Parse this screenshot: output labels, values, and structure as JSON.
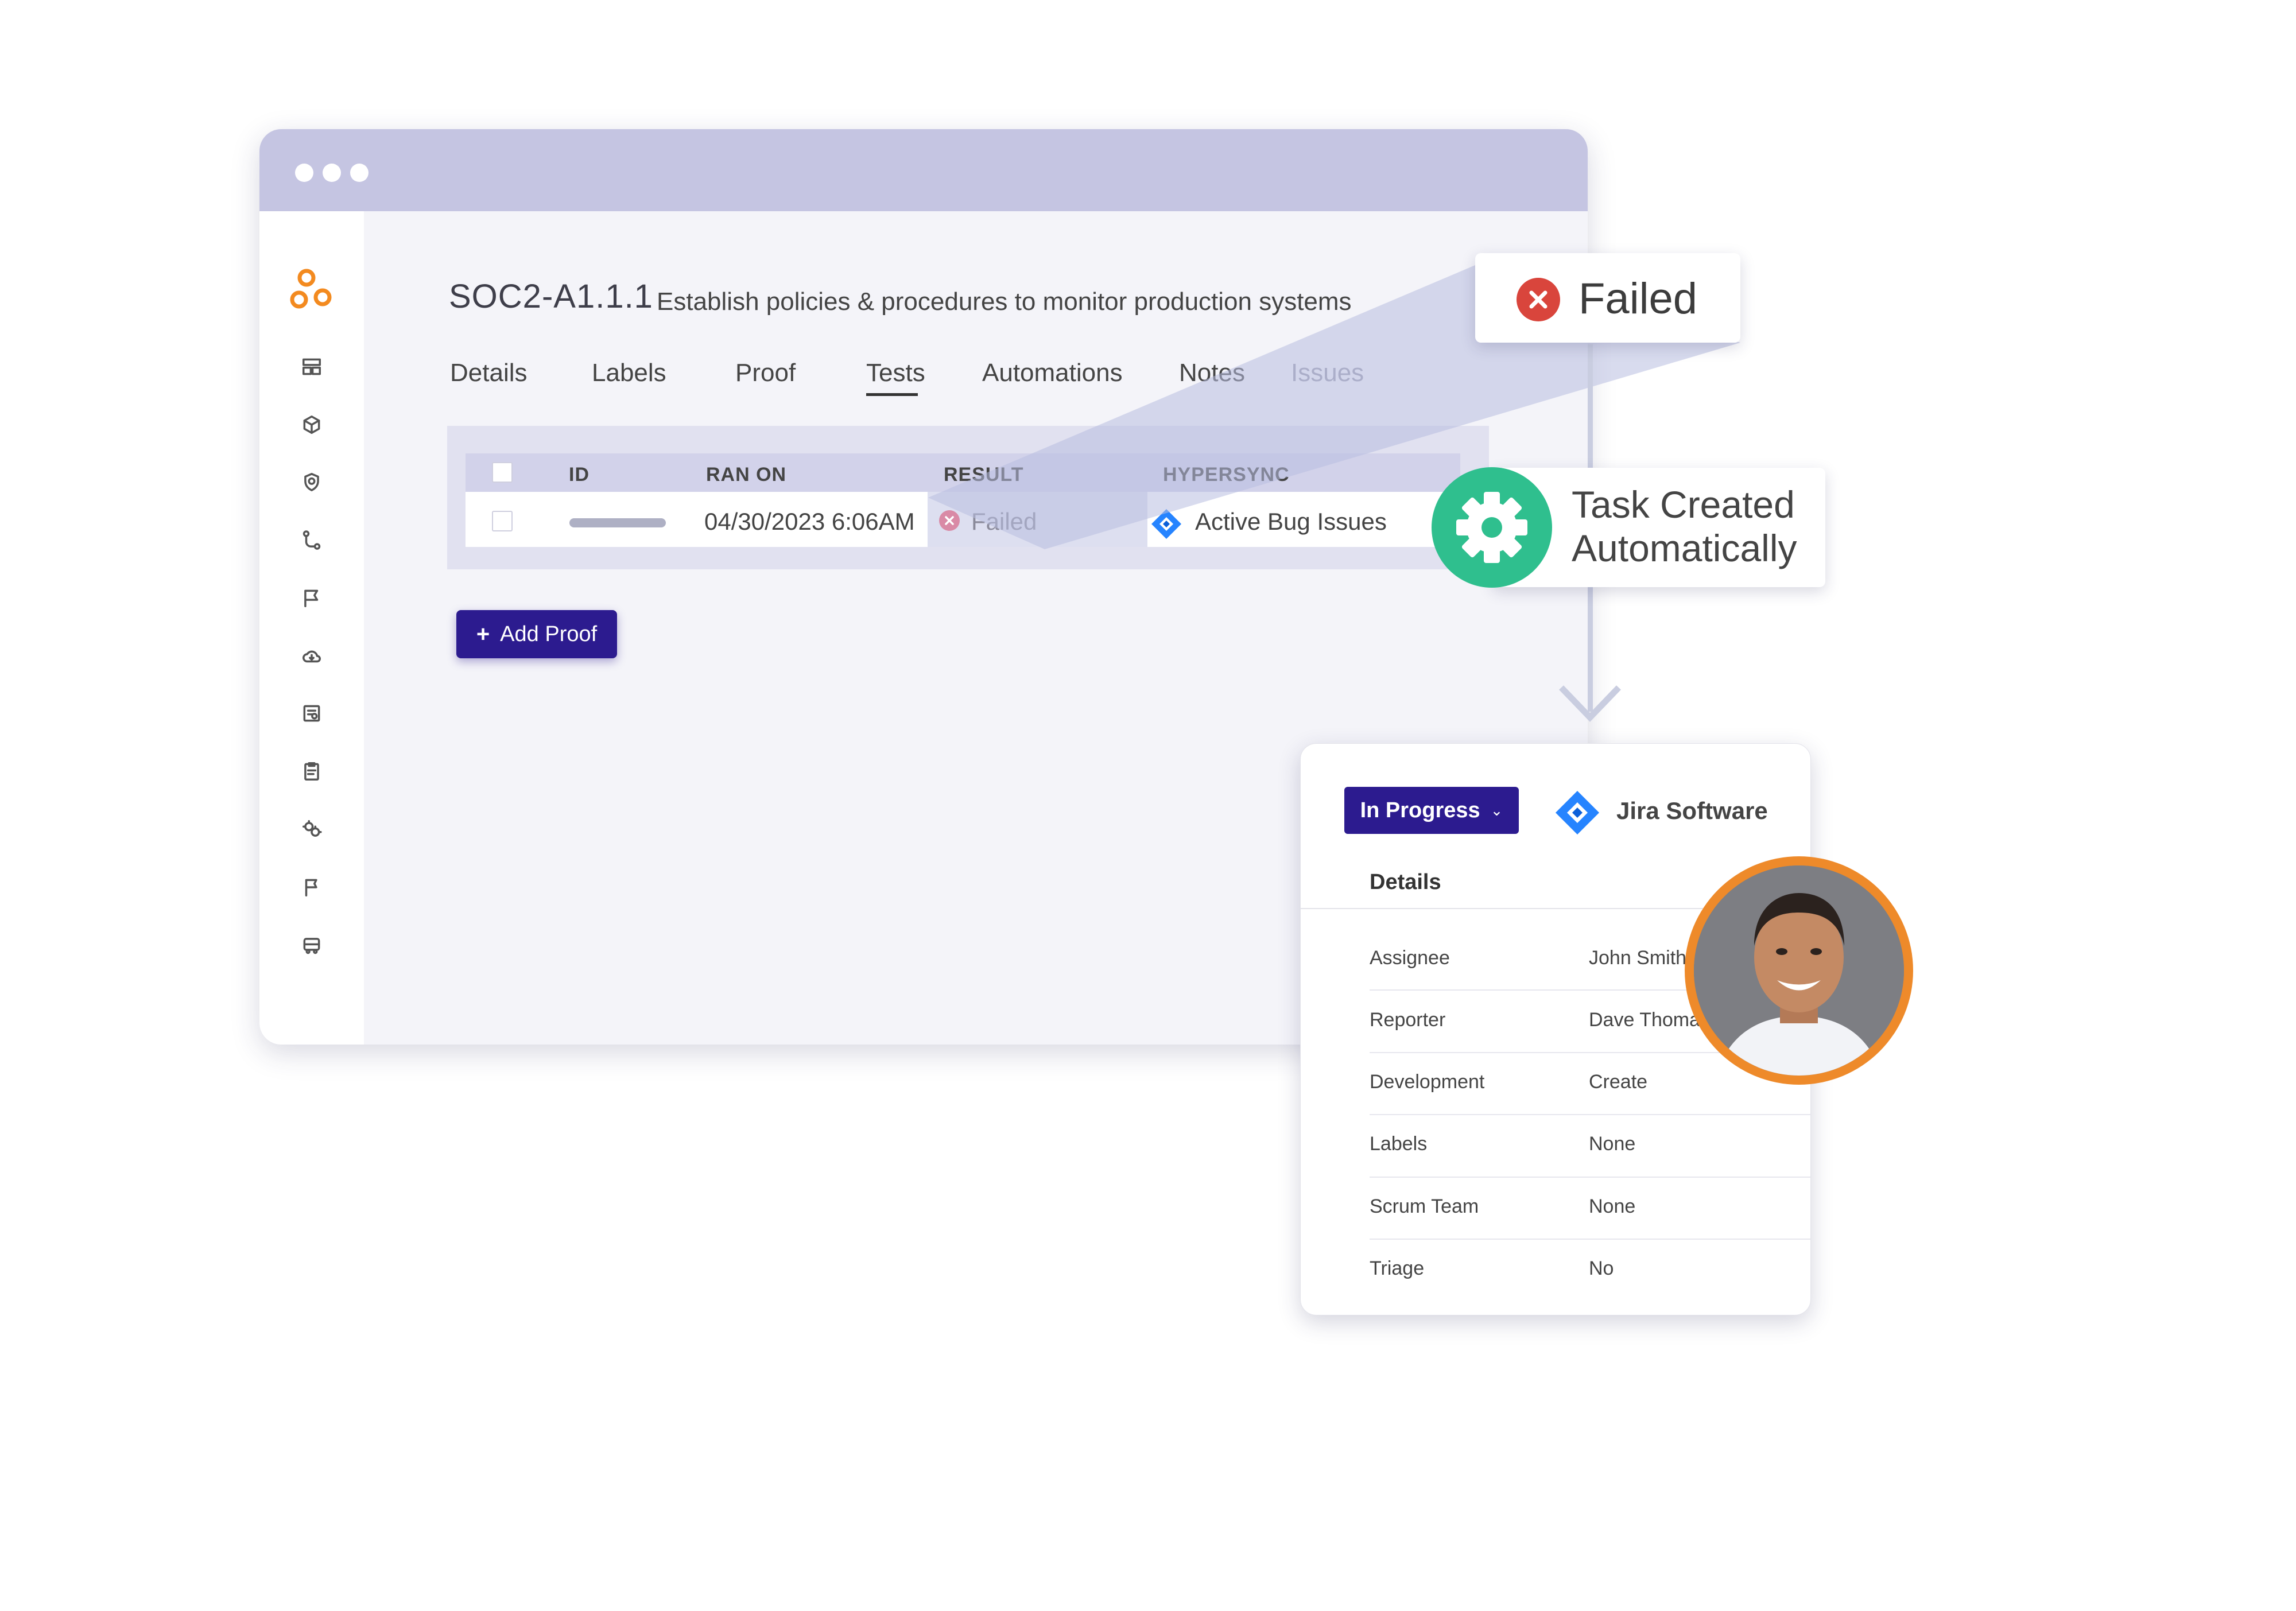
{
  "window": {
    "control_id": "SOC2-A1.1.1",
    "control_description": "Establish policies & procedures to monitor production systems",
    "tabs": [
      {
        "label": "Details"
      },
      {
        "label": "Labels"
      },
      {
        "label": "Proof"
      },
      {
        "label": "Tests",
        "active": true
      },
      {
        "label": "Automations"
      },
      {
        "label": "Notes"
      },
      {
        "label": "Issues",
        "dimmed": true
      }
    ],
    "table": {
      "columns": [
        "ID",
        "RAN ON",
        "RESULT",
        "HYPERSYNC"
      ],
      "rows": [
        {
          "id": "",
          "ran_on": "04/30/2023 6:06AM",
          "result": "Failed",
          "hypersync": "Active Bug Issues"
        }
      ]
    },
    "add_proof_label": "Add Proof",
    "sidebar_icons": [
      "dashboard-icon",
      "box-icon",
      "shield-icon",
      "workflow-icon",
      "flag-note-icon",
      "cloud-icon",
      "report-icon",
      "clipboard-icon",
      "settings-icon",
      "flag-icon",
      "bus-icon"
    ]
  },
  "callouts": {
    "failed": "Failed",
    "task_line1": "Task Created",
    "task_line2": "Automatically"
  },
  "jira": {
    "status": "In Progress",
    "product": "Jira Software",
    "details_title": "Details",
    "fields": [
      {
        "label": "Assignee",
        "value": "John Smith"
      },
      {
        "label": "Reporter",
        "value": "Dave Thomas"
      },
      {
        "label": "Development",
        "value": "Create"
      },
      {
        "label": "Labels",
        "value": "None"
      },
      {
        "label": "Scrum Team",
        "value": "None"
      },
      {
        "label": "Triage",
        "value": "No"
      }
    ]
  },
  "colors": {
    "brand_orange": "#f38a1f",
    "primary_purple": "#2c1b8f",
    "success_green": "#2fbf8e",
    "error_red": "#d9453c",
    "jira_blue": "#2684ff"
  }
}
